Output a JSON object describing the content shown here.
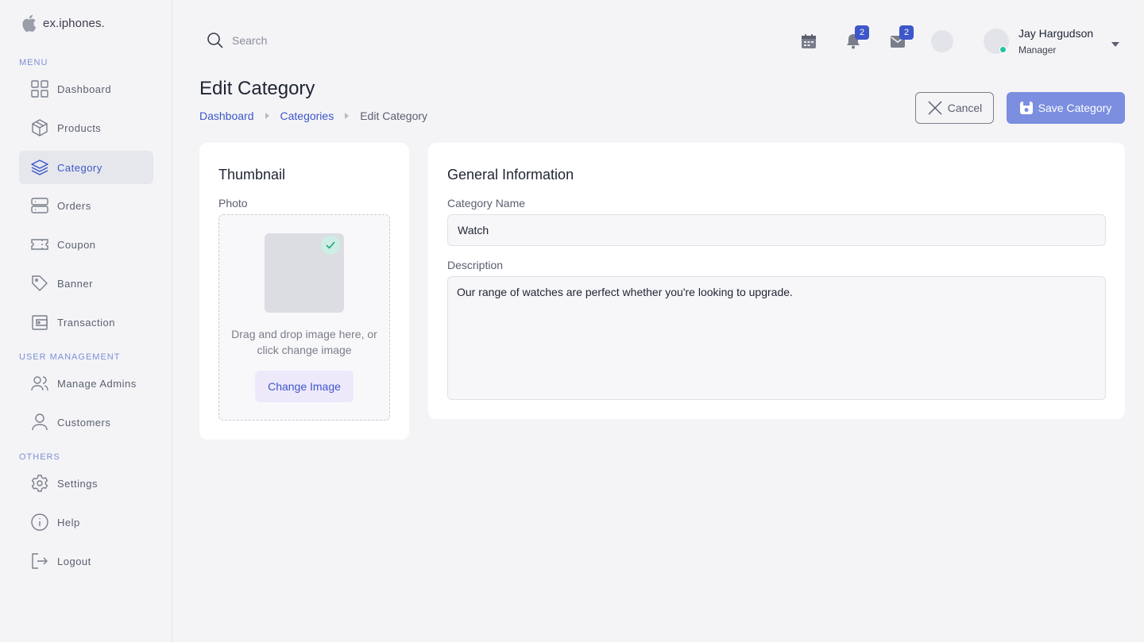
{
  "brand": {
    "name": "ex.iphones.",
    "icon": "apple-icon"
  },
  "sidebar": {
    "sections": {
      "menu": "MENU",
      "user_management": "USER MANAGEMENT",
      "others": "OTHERS"
    },
    "items": [
      {
        "label": "Dashboard",
        "icon": "grid-icon"
      },
      {
        "label": "Products",
        "icon": "box-icon"
      },
      {
        "label": "Category",
        "icon": "layers-icon",
        "active": true
      },
      {
        "label": "Orders",
        "icon": "server-icon"
      },
      {
        "label": "Coupon",
        "icon": "ticket-icon"
      },
      {
        "label": "Banner",
        "icon": "tag-icon"
      },
      {
        "label": "Transaction",
        "icon": "wallet-icon"
      },
      {
        "label": "Manage Admins",
        "icon": "users-icon"
      },
      {
        "label": "Customers",
        "icon": "user-icon"
      },
      {
        "label": "Settings",
        "icon": "gear-icon"
      },
      {
        "label": "Help",
        "icon": "info-icon"
      },
      {
        "label": "Logout",
        "icon": "logout-icon"
      }
    ]
  },
  "topbar": {
    "search_placeholder": "Search",
    "notifications_count": "2",
    "messages_count": "2",
    "user": {
      "name": "Jay Hargudson",
      "role": "Manager"
    }
  },
  "page": {
    "title": "Edit Category",
    "breadcrumb": [
      "Dashboard",
      "Categories",
      "Edit Category"
    ],
    "cancel_label": "Cancel",
    "save_label": "Save Category"
  },
  "thumbnail": {
    "title": "Thumbnail",
    "photo_label": "Photo",
    "drop_text": "Drag and drop image here, or click change image",
    "change_label": "Change Image"
  },
  "general": {
    "title": "General Information",
    "name_label": "Category Name",
    "name_value": "Watch",
    "description_label": "Description",
    "description_value": "Our range of watches are perfect whether you're looking to upgrade."
  },
  "colors": {
    "accent": "#3d56c9",
    "save_button": "#7b8ee0",
    "online_status": "#22c4a3"
  }
}
